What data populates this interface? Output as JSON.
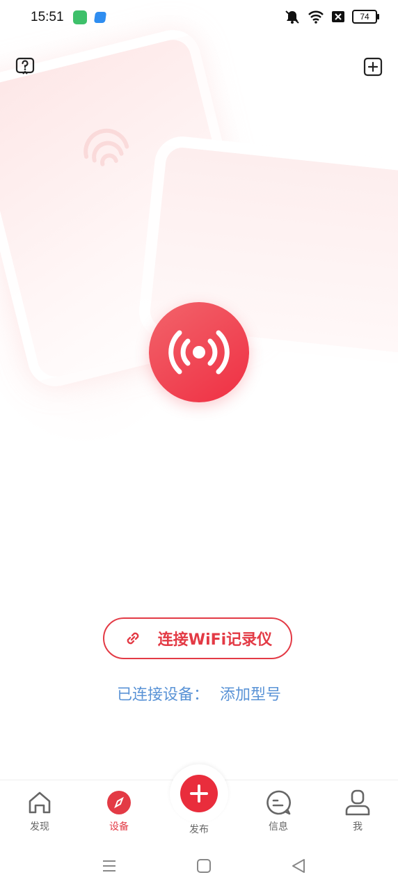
{
  "status_bar": {
    "time": "15:51",
    "battery": "74",
    "icons": [
      "mute-icon",
      "wifi-icon",
      "sim-off-icon",
      "battery-icon"
    ]
  },
  "header": {
    "left_icon": "help-icon",
    "right_icon": "add-square-icon"
  },
  "main": {
    "center_icon": "broadcast-icon",
    "connect_button_label": "连接WiFi记录仪",
    "connected_label": "已连接设备：",
    "add_model_link": "添加型号"
  },
  "bottom_nav": {
    "items": [
      {
        "label": "发现",
        "icon": "home-icon",
        "active": false
      },
      {
        "label": "设备",
        "icon": "compass-icon",
        "active": true
      },
      {
        "label": "发布",
        "icon": "plus-icon",
        "active": false
      },
      {
        "label": "信息",
        "icon": "chat-icon",
        "active": false
      },
      {
        "label": "我",
        "icon": "user-icon",
        "active": false
      }
    ]
  },
  "colors": {
    "accent": "#e33a45",
    "link": "#5a93d6"
  }
}
